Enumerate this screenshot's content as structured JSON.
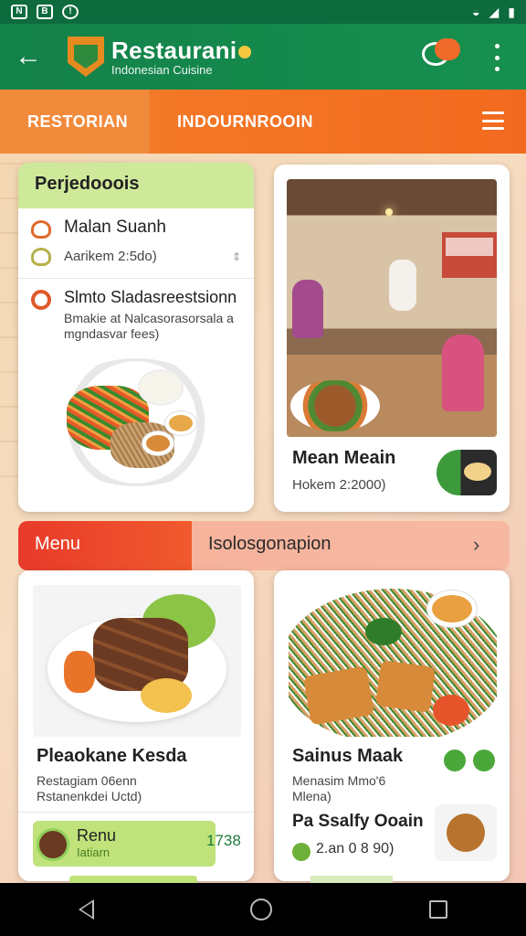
{
  "status_bar": {
    "left_icons": [
      "N",
      "B",
      "!"
    ],
    "right_icons": [
      "wifi",
      "signal",
      "battery"
    ]
  },
  "app_bar": {
    "title": "Restaurani",
    "subtitle": "Indonesian Cuisine",
    "chat_badge": ""
  },
  "tabs": [
    {
      "label": "RESTORIAN"
    },
    {
      "label": "INDOURNROOIN"
    }
  ],
  "card_top_left": {
    "header": "Perjedooois",
    "items": [
      {
        "title": "Malan Suanh",
        "sub": "Aarikem 2:5do)",
        "icon": "heart-icon"
      },
      {
        "title": "",
        "sub": "",
        "icon": "heart-icon"
      },
      {
        "title": "Slmto Sladasreestsionn",
        "desc": "Bmakie at Nalcasorasorsala a mgndasvar fees)",
        "icon": "badge-icon"
      }
    ]
  },
  "card_top_right": {
    "name": "Mean Meain",
    "sub": "Hokem 2:2000)"
  },
  "menu_strip": {
    "menu_label": "Menu",
    "section_label": "Isolosgonapion",
    "arrow": "›"
  },
  "card_bottom_left": {
    "name": "Pleaokane Kesda",
    "desc_line1": "Restagiam 06enn",
    "desc_line2": "Rstanenkdei Uctd)",
    "footer_title": "Renu",
    "footer_sub": "Iatiarn",
    "price": "1738"
  },
  "card_bottom_right": {
    "name": "Sainus Maak",
    "desc_line1": "Menasim Mmo'6",
    "desc_line2": "Mlena)",
    "name2": "Pa Ssalfy Ooain",
    "price": "2.an 0 8 90)"
  },
  "colors": {
    "primary_green": "#13814a",
    "tab_orange": "#f26a1f",
    "menu_red": "#e83a2a",
    "light_green": "#cfe99a"
  }
}
